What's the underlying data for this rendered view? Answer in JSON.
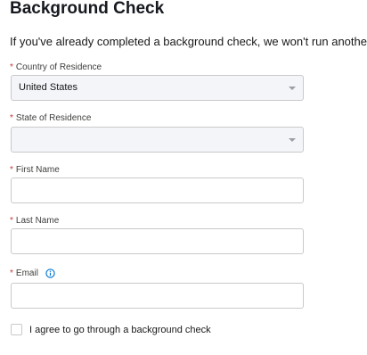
{
  "page": {
    "title": "Background Check",
    "intro": "If you've already completed a background check, we won't run another."
  },
  "form": {
    "required_marker": "*",
    "country": {
      "label": "Country of Residence",
      "value": "United States"
    },
    "state": {
      "label": "State of Residence",
      "value": ""
    },
    "first_name": {
      "label": "First Name",
      "value": ""
    },
    "last_name": {
      "label": "Last Name",
      "value": ""
    },
    "email": {
      "label": "Email",
      "value": "",
      "icon": "info-icon"
    },
    "agree": {
      "label": "I agree to go through a background check",
      "checked": false
    }
  },
  "colors": {
    "required": "#c23934",
    "info_icon": "#0176d3",
    "select_bg": "#f3f5f9",
    "border": "#c9c9c9"
  }
}
